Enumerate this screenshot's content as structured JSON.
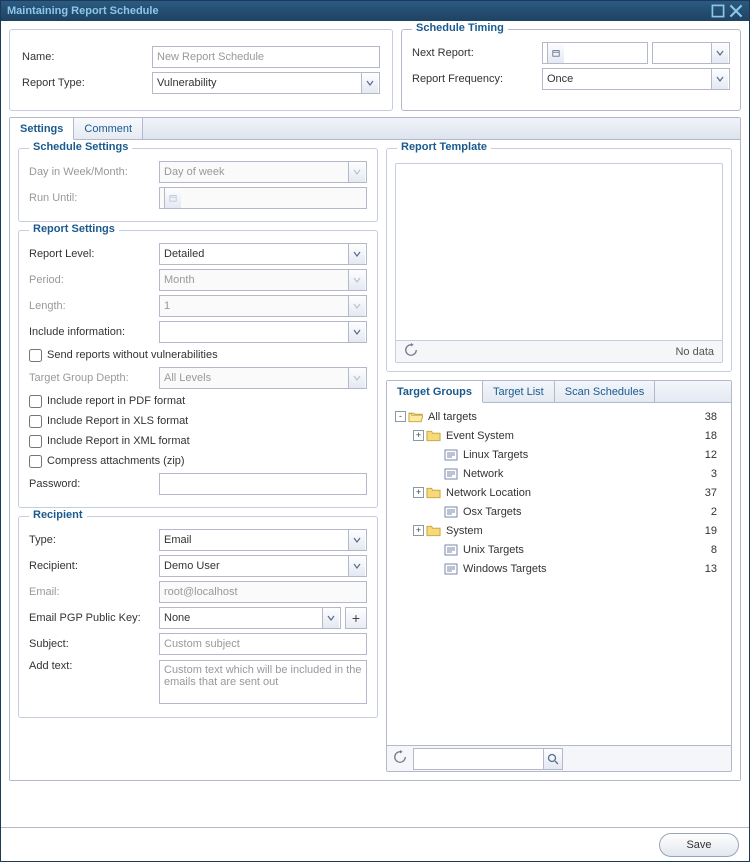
{
  "window": {
    "title": "Maintaining Report Schedule"
  },
  "top": {
    "name_label": "Name:",
    "name_placeholder": "New Report Schedule",
    "report_type_label": "Report Type:",
    "report_type_value": "Vulnerability"
  },
  "schedule_timing": {
    "legend": "Schedule Timing",
    "next_report_label": "Next Report:",
    "next_report_value": "",
    "time_value": "",
    "frequency_label": "Report Frequency:",
    "frequency_value": "Once"
  },
  "tabs": {
    "settings": "Settings",
    "comment": "Comment"
  },
  "schedule_settings": {
    "legend": "Schedule Settings",
    "day_label": "Day in Week/Month:",
    "day_value": "Day of week",
    "run_until_label": "Run Until:",
    "run_until_value": ""
  },
  "report_settings": {
    "legend": "Report Settings",
    "level_label": "Report Level:",
    "level_value": "Detailed",
    "period_label": "Period:",
    "period_value": "Month",
    "length_label": "Length:",
    "length_value": "1",
    "include_info_label": "Include information:",
    "include_info_value": "",
    "send_without_vuln": "Send reports without vulnerabilities",
    "tg_depth_label": "Target Group Depth:",
    "tg_depth_value": "All Levels",
    "pdf": "Include report in PDF format",
    "xls": "Include Report in XLS format",
    "xml": "Include Report in XML format",
    "zip": "Compress attachments (zip)",
    "password_label": "Password:",
    "password_value": ""
  },
  "recipient": {
    "legend": "Recipient",
    "type_label": "Type:",
    "type_value": "Email",
    "recipient_label": "Recipient:",
    "recipient_value": "Demo User",
    "email_label": "Email:",
    "email_value": "root@localhost",
    "pgp_label": "Email PGP Public Key:",
    "pgp_value": "None",
    "subject_label": "Subject:",
    "subject_placeholder": "Custom subject",
    "addtext_label": "Add text:",
    "addtext_placeholder": "Custom text which will be included in the emails that are sent out"
  },
  "template": {
    "legend": "Report Template",
    "nodata": "No data"
  },
  "target_tabs": {
    "groups": "Target Groups",
    "list": "Target List",
    "schedules": "Scan Schedules"
  },
  "tree": [
    {
      "indent": 0,
      "exp": "-",
      "icon": "folder-open",
      "label": "All targets",
      "count": "38"
    },
    {
      "indent": 1,
      "exp": "+",
      "icon": "folder",
      "label": "Event System",
      "count": "18"
    },
    {
      "indent": 2,
      "exp": "",
      "icon": "leaf",
      "label": "Linux Targets",
      "count": "12"
    },
    {
      "indent": 2,
      "exp": "",
      "icon": "leaf",
      "label": "Network",
      "count": "3"
    },
    {
      "indent": 1,
      "exp": "+",
      "icon": "folder",
      "label": "Network Location",
      "count": "37"
    },
    {
      "indent": 2,
      "exp": "",
      "icon": "leaf",
      "label": "Osx Targets",
      "count": "2"
    },
    {
      "indent": 1,
      "exp": "+",
      "icon": "folder",
      "label": "System",
      "count": "19"
    },
    {
      "indent": 2,
      "exp": "",
      "icon": "leaf",
      "label": "Unix Targets",
      "count": "8"
    },
    {
      "indent": 2,
      "exp": "",
      "icon": "leaf",
      "label": "Windows Targets",
      "count": "13"
    }
  ],
  "footer": {
    "save": "Save"
  }
}
